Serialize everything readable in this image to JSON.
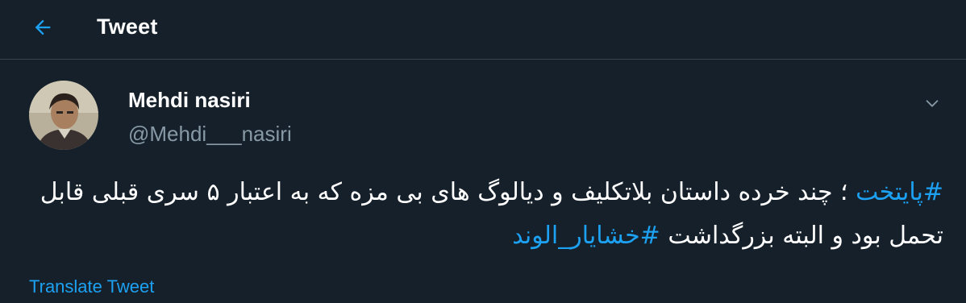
{
  "colors": {
    "background": "#15202b",
    "accent": "#1da1f2",
    "secondary_text": "#8899a6",
    "divider": "#38444d"
  },
  "header": {
    "back_icon": "arrow-left-icon",
    "title": "Tweet"
  },
  "tweet": {
    "author_name": "Mehdi nasiri",
    "author_handle": "@Mehdi___nasiri",
    "more_icon": "chevron-down-icon",
    "hashtag_1": "#پایتخت",
    "text_part_1": " ؛ چند خرده داستان بلاتکلیف و دیالوگ های بی مزه که به اعتبار ۵ سری قبلی قابل تحمل بود و البته  بزرگداشت ",
    "hashtag_2": "#خشایار_الوند",
    "translate_label": "Translate Tweet"
  }
}
